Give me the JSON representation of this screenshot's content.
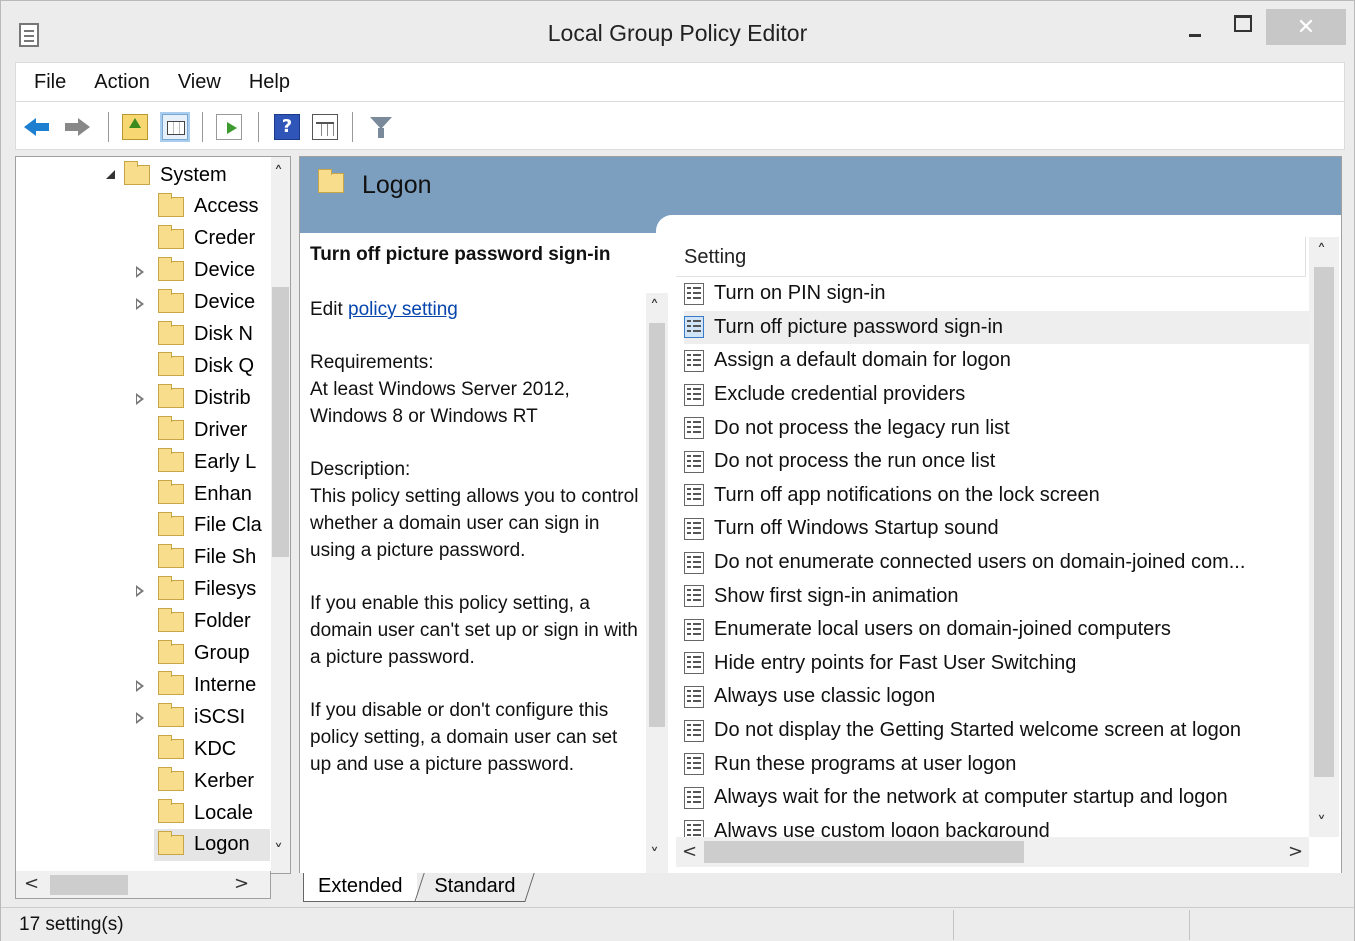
{
  "window": {
    "title": "Local Group Policy Editor",
    "close_glyph": "✕"
  },
  "menu": [
    "File",
    "Action",
    "View",
    "Help"
  ],
  "toolbar": {
    "help_glyph": "?"
  },
  "tree": {
    "items": [
      {
        "label": "System",
        "expander": "expanded"
      },
      {
        "label": "Access",
        "expander": "none"
      },
      {
        "label": "Creder",
        "expander": "none"
      },
      {
        "label": "Device",
        "expander": "collapsed"
      },
      {
        "label": "Device",
        "expander": "collapsed"
      },
      {
        "label": "Disk N",
        "expander": "none"
      },
      {
        "label": "Disk Q",
        "expander": "none"
      },
      {
        "label": "Distrib",
        "expander": "collapsed"
      },
      {
        "label": "Driver",
        "expander": "none"
      },
      {
        "label": "Early L",
        "expander": "none"
      },
      {
        "label": "Enhan",
        "expander": "none"
      },
      {
        "label": "File Cla",
        "expander": "none"
      },
      {
        "label": "File Sh",
        "expander": "none"
      },
      {
        "label": "Filesys",
        "expander": "collapsed"
      },
      {
        "label": "Folder",
        "expander": "none"
      },
      {
        "label": "Group",
        "expander": "none"
      },
      {
        "label": "Interne",
        "expander": "collapsed"
      },
      {
        "label": "iSCSI",
        "expander": "collapsed"
      },
      {
        "label": "KDC",
        "expander": "none"
      },
      {
        "label": "Kerber",
        "expander": "none"
      },
      {
        "label": "Locale",
        "expander": "none"
      },
      {
        "label": "Logon",
        "expander": "none",
        "selected": true
      }
    ]
  },
  "banner": {
    "title": "Logon"
  },
  "description": {
    "title": "Turn off picture password sign-in",
    "edit_prefix": "Edit",
    "edit_link": "policy setting",
    "requirements_label": "Requirements:",
    "requirements": "At least Windows Server 2012, Windows 8 or Windows RT",
    "description_label": "Description:",
    "para1": "This policy setting allows you to control whether a domain user can sign in using a picture password.",
    "para2": "If you enable this policy setting, a domain user can't set up or sign in with a picture password.",
    "para3": "If you disable or don't configure this policy setting, a domain user can set up and use a picture password."
  },
  "settings": {
    "column_header": "Setting",
    "selected_index": 1,
    "rows": [
      "Turn on PIN sign-in",
      "Turn off picture password sign-in",
      "Assign a default domain for logon",
      "Exclude credential providers",
      "Do not process the legacy run list",
      "Do not process the run once list",
      "Turn off app notifications on the lock screen",
      "Turn off Windows Startup sound",
      "Do not enumerate connected users on domain-joined com...",
      "Show first sign-in animation",
      "Enumerate local users on domain-joined computers",
      "Hide entry points for Fast User Switching",
      "Always use classic logon",
      "Do not display the Getting Started welcome screen at logon",
      "Run these programs at user logon",
      "Always wait for the network at computer startup and logon",
      "Always use custom logon background"
    ]
  },
  "tabs": {
    "extended": "Extended",
    "standard": "Standard"
  },
  "status": {
    "text": "17 setting(s)"
  },
  "glyphs": {
    "up": "˄",
    "down": "˅",
    "left": "<",
    "right": ">"
  }
}
